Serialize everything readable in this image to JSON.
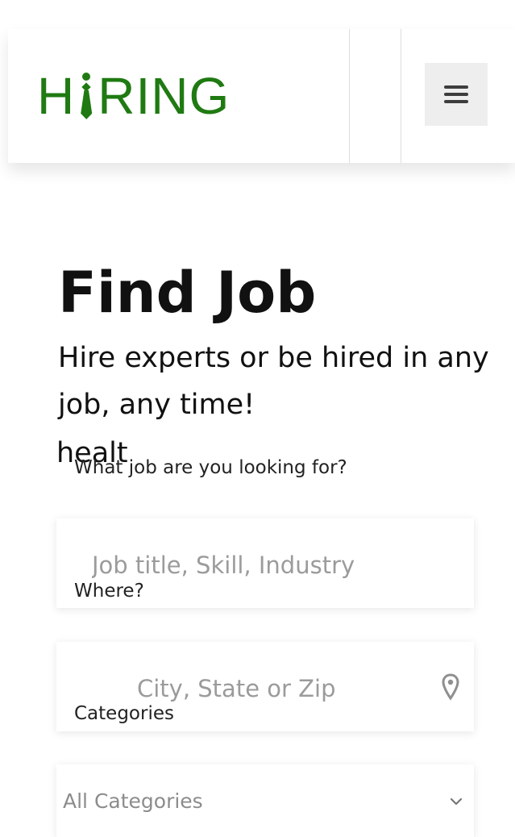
{
  "header": {
    "logo_text_left": "H",
    "logo_text_right": "RING",
    "logo_icon": "tie-icon",
    "menu_icon": "hamburger-menu-icon",
    "brand_color": "#1f7a12"
  },
  "hero": {
    "title": "Find Job",
    "subtitle": "Hire experts or be hired in any job, any time!",
    "stray_text": "healt"
  },
  "form": {
    "job_label": "What job are you looking for?",
    "job_placeholder": "Job title, Skill, Industry",
    "location_label": "Where?",
    "location_placeholder": "City, State or Zip",
    "location_icon": "location-pin-icon",
    "categories_label": "Categories",
    "categories_selected": "All Categories",
    "categories_icon": "chevron-down-icon"
  }
}
